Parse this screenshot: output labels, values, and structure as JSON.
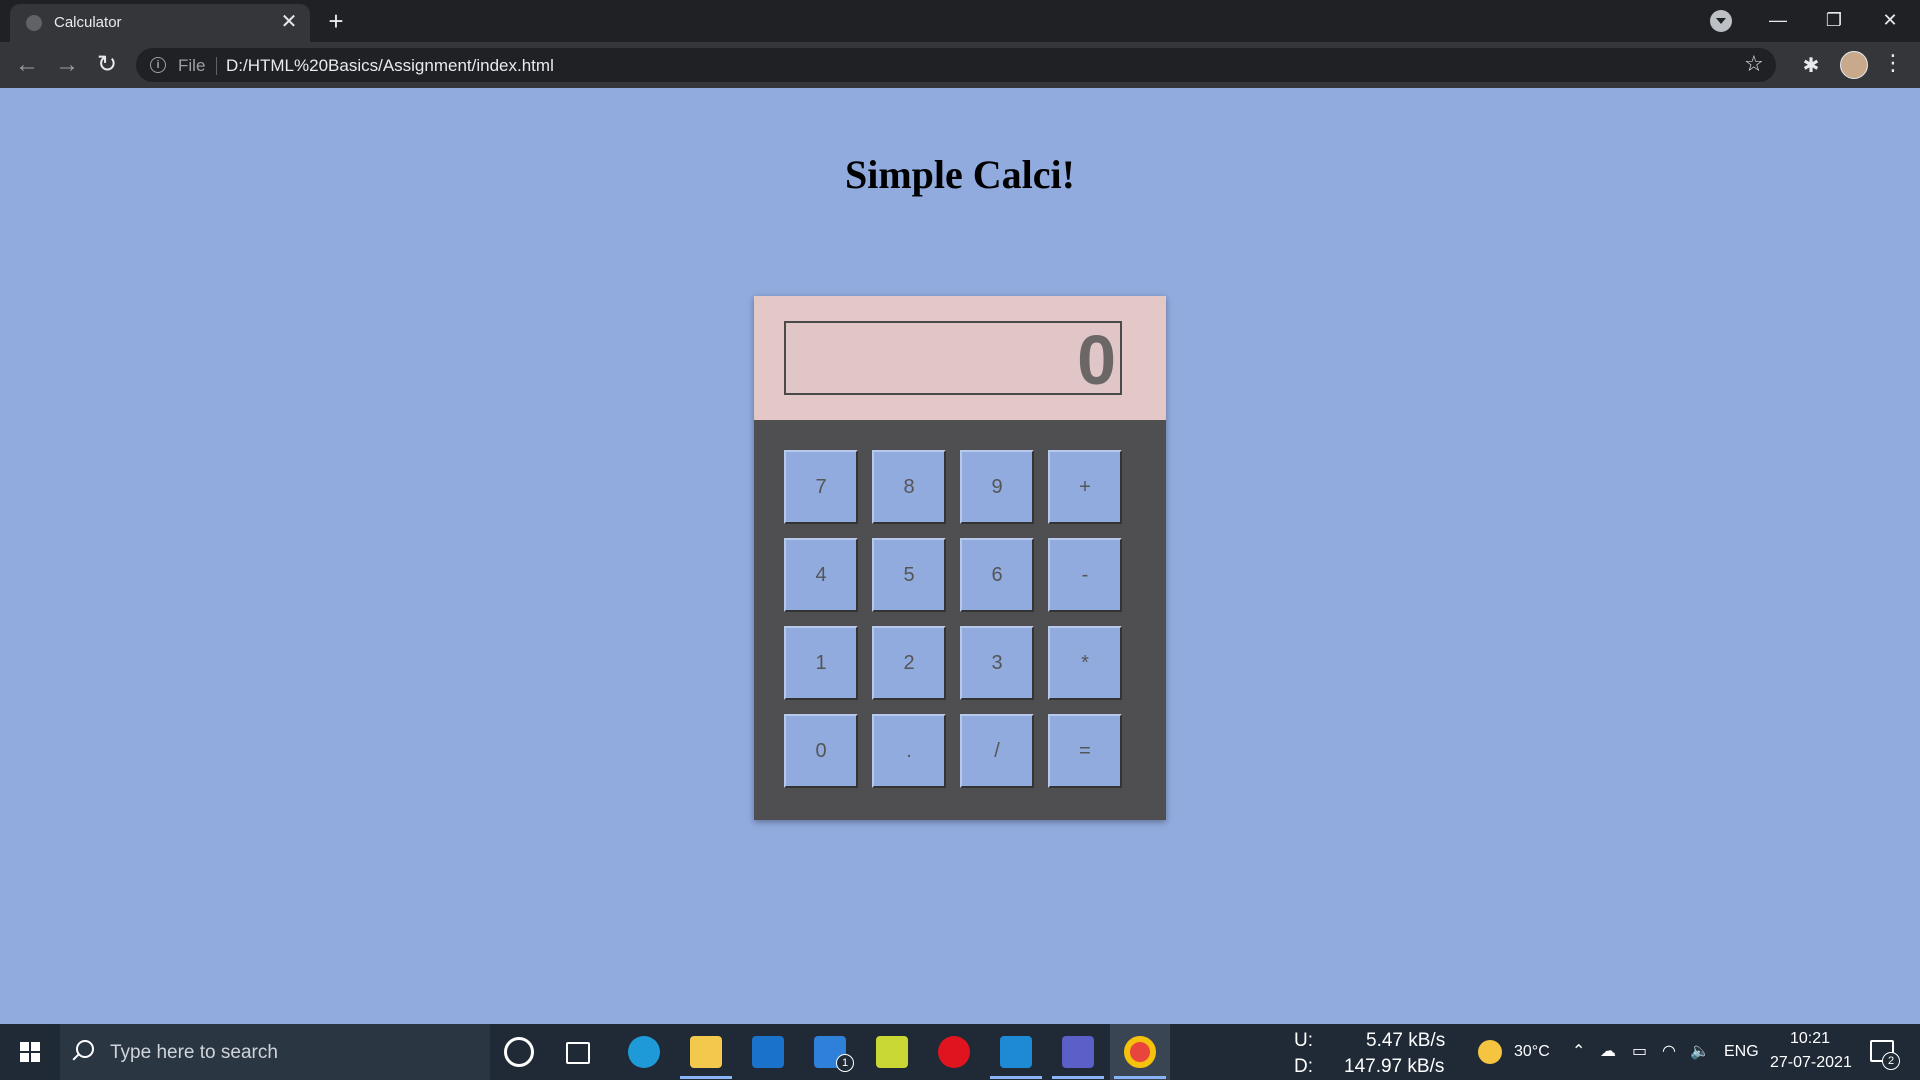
{
  "browser": {
    "tab_title": "Calculator",
    "tab_close": "✕",
    "new_tab": "+",
    "scheme_label": "File",
    "url": "D:/HTML%20Basics/Assignment/index.html",
    "back_icon": "←",
    "forward_icon": "→",
    "reload_icon": "↻",
    "info_icon": "i",
    "star_icon": "☆",
    "extensions_icon": "✱",
    "menu_icon": "⋮",
    "window_minimize": "—",
    "window_restore": "❐",
    "window_close": "✕"
  },
  "page": {
    "title": "Simple Calci!"
  },
  "calculator": {
    "display_value": "0",
    "keys": [
      [
        "7",
        "8",
        "9",
        "+"
      ],
      [
        "4",
        "5",
        "6",
        "-"
      ],
      [
        "1",
        "2",
        "3",
        "*"
      ],
      [
        "0",
        ".",
        "/",
        "="
      ]
    ]
  },
  "taskbar": {
    "search_placeholder": "Type here to search",
    "mail_badge": "1",
    "upload_label": "U:",
    "upload_speed": "5.47 kB/s",
    "download_label": "D:",
    "download_speed": "147.97 kB/s",
    "temperature": "30°C",
    "language": "ENG",
    "time": "10:21",
    "date": "27-07-2021",
    "notifications_count": "2"
  },
  "colors": {
    "page_background": "#91abdf",
    "calculator_body": "#4f4e51",
    "calculator_header": "#e4c8c8",
    "key_background": "#91abdf"
  }
}
